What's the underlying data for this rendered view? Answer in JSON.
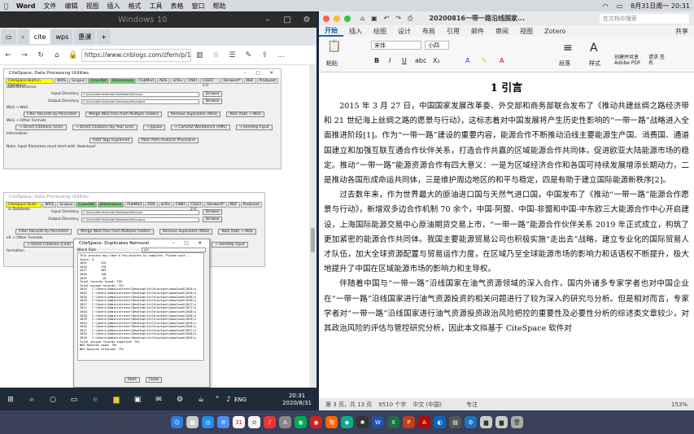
{
  "menubar": {
    "app": "Word",
    "items": [
      "文件",
      "编辑",
      "视图",
      "插入",
      "格式",
      "工具",
      "表格",
      "窗口",
      "帮助"
    ],
    "datetime": "8月31日周一 20:31"
  },
  "vm": {
    "title": "Windows 10"
  },
  "edge": {
    "tabs": [
      "cite",
      "wps",
      "惠课"
    ],
    "url": "https://www.cnblogs.com/zfern/p/1"
  },
  "cs1": {
    "title": "CiteSpace: Data Processing Utilities",
    "tabs": [
      "CiteSpace Built-in Database",
      "WOS",
      "Scopus",
      "CrossRef",
      "Dimensions",
      "PubMed",
      "ADS",
      "arXiv",
      "CNKI",
      "CSSCI 2.0",
      "Derwent*",
      "NSF",
      "ProQuest"
    ],
    "section1": "Data Directories",
    "input_label": "Input Directory",
    "input_value": "C:\\Users\\Administrator\\Desktop\\title\\input",
    "output_label": "Output Directory",
    "output_value": "C:\\Users\\Administrator\\Desktop\\title\\output",
    "browse": "Browse",
    "wos_wos": "WoS → WoS",
    "wos_buttons": [
      "Filter Records by Percentile",
      "Merge WoS Files from Multiple Folders",
      "Remove duplicates (WoS)",
      "WoS (tab) → WoS"
    ],
    "other": "WoS → Other Formats",
    "other_buttons": [
      "→ Direct Citations (Link)",
      "→ Direct Citations (by Year Link)",
      "→ Jigsaw",
      "→ CartoAZ Workbench (XML)",
      "→ SemRep Input"
    ],
    "info": "Information",
    "info_buttons": [
      "Field Tags Explained",
      "Main Path Analysis Procedure"
    ],
    "note": "Note: input filenames must start with 'download'."
  },
  "cs2": {
    "title": "CiteSpace: Data Processing Utilities",
    "tabs": [
      "CiteSpace Built-in Database",
      "WOS",
      "Scopus",
      "CrossRef",
      "Dimensions",
      "PubMed",
      "ADS",
      "arXiv",
      "CNKI",
      "CSSCI 2.0",
      "Derwent*",
      "NSF",
      "ProQuest"
    ],
    "input_label": "Input Directory",
    "input_value": "C:\\Users\\Administrator\\Desktop\\title\\input",
    "output_label": "Output Directory",
    "output_value": "C:\\Users\\Administrator\\Desktop\\title\\output",
    "browse": "Browse",
    "wos_buttons": [
      "Filter Records by Percentile",
      "Merge WoS Files from Multiple Folders",
      "Remove duplicates (WoS)",
      "WoS (tab) → WoS"
    ],
    "other": "oS → Other Formats",
    "other_buttons": [
      "→ Direct Citations (Link)",
      "→ SemRep Input"
    ],
    "info": "formation"
  },
  "dup": {
    "title": "CiteSpace: Duplicates Removal",
    "block_label": "Block Size",
    "block_value": "100",
    "log": "This process may take a few minutes to complete. Please wait...\nYears: 5\n2015        215\n2016        176\n2017        163\n2018        148\n2019         26\nTotal records found: 755\nTotal unique records: 751\n2015   C:\\Users\\Administrator\\Desktop\\title\\output\\download\\2015\\u\n2016   C:\\Users\\Administrator\\Desktop\\title\\output\\download\\2016\\u\n2016   C:\\Users\\Administrator\\Desktop\\title\\output\\download\\2016\\u\n2016   C:\\Users\\Administrator\\Desktop\\title\\output\\download\\2016\\u\n2017   C:\\Users\\Administrator\\Desktop\\title\\output\\download\\2017\\u\n2017   C:\\Users\\Administrator\\Desktop\\title\\output\\download\\2017\\u\n2018   C:\\Users\\Administrator\\Desktop\\title\\output\\download\\2018\\u\n2018   C:\\Users\\Administrator\\Desktop\\title\\output\\download\\2018\\u\n2019   C:\\Users\\Administrator\\Desktop\\title\\output\\download\\2019\\u\n2015   C:\\Users\\Administrator\\Desktop\\title\\output\\download\\2015\\u\n2016   C:\\Users\\Administrator\\Desktop\\title\\output\\download\\2016\\u\n2017   C:\\Users\\Administrator\\Desktop\\title\\output\\download\\2017\\u\n2018   C:\\Users\\Administrator\\Desktop\\title\\output\\download\\2018\\u\n2019   C:\\Users\\Administrator\\Desktop\\title\\output\\download\\2019\\u\nTotal unique records exported: 751\nWOS Records read: 755\nWOS Records retained: 751",
    "start": "Start",
    "close": "Close"
  },
  "taskbar": {
    "lang": "ENG",
    "time": "20:31",
    "date": "2020/8/31"
  },
  "word": {
    "doc_title": "20200816一带一路沿线国家...",
    "search": "在文档中搜索",
    "tabs": [
      "开始",
      "插入",
      "绘图",
      "设计",
      "布局",
      "引用",
      "邮件",
      "审阅",
      "视图",
      "Zotero"
    ],
    "share": "共享",
    "font": "宋体",
    "size": "小四",
    "paragraph": "段落",
    "styles": "样式",
    "adobe": "创建并共享 Adobe PDF",
    "sign": "请求 签名",
    "paste": "粘贴",
    "heading": "1   引言",
    "p1": "2015 年 3 月 27 日，中国国家发展改革委、外交部和商务部联合发布了《推动共建丝绸之路经济带和 21 世纪海上丝绸之路的愿景与行动》，这标志着对中国发展将产生历史性影响的“一带一路”战略进入全面推进阶段[1]。作为“一带一路”建设的重要内容，能源合作不断推动沿线主要能源生产国、消费国、通道国建立和加强互联互通合作伙伴关系，打造合作共赢的区域能源合作共同体，促进欧亚大陆能源市场的稳定。推动“一带一路”能源资源合作有四大意义：一是为区域经济合作和各国可持续发展增添长期动力，二是推动各国形成命运共同体，三是维护周边地区的和平与稳定，四是有助于建立国际能源新秩序[2]。",
    "p2": "过去数年来，作为世界最大的原油进口国与天然气进口国，中国发布了《推动“一带一路”能源合作愿景与行动》，新增双多边合作机制 70 余个，中国-阿盟、中国-非盟和中国-中东欧三大能源合作中心开启建设，上海国际能源交易中心原油期货交易上市，“一带一路”能源合作伙伴关系 2019 年正式成立，构筑了更加紧密的能源合作共同体。我国主要能源贸易公司也积极实施“走出去”战略，建立专业化的国际贸易人才队伍，加大全球资源配置与贸易运作力度，在区域乃至全球能源市场的影响力和话语权不断提升，极大地提升了中国在区域能源市场的影响力和主导权。",
    "p3": "伴随着中国与“一带一路”沿线国家在油气资源领域的深入合作，国内外诸多专家学者也对中国企业在“一带一路”沿线国家进行油气资源投资的相关问题进行了较为深入的研究与分析。但是相对而言，专家学者对“一带一路”沿线国家进行油气资源投资政治风险把控的重要性及必要性分析的综述类文章较少，对其政治风险的评估与管控研究分析，因此本文拟基于 CiteSpace 软件对",
    "status": [
      "第 3 页，共 13 页",
      "9510 个字",
      "中文 (中国)",
      "专注",
      "153%"
    ]
  }
}
